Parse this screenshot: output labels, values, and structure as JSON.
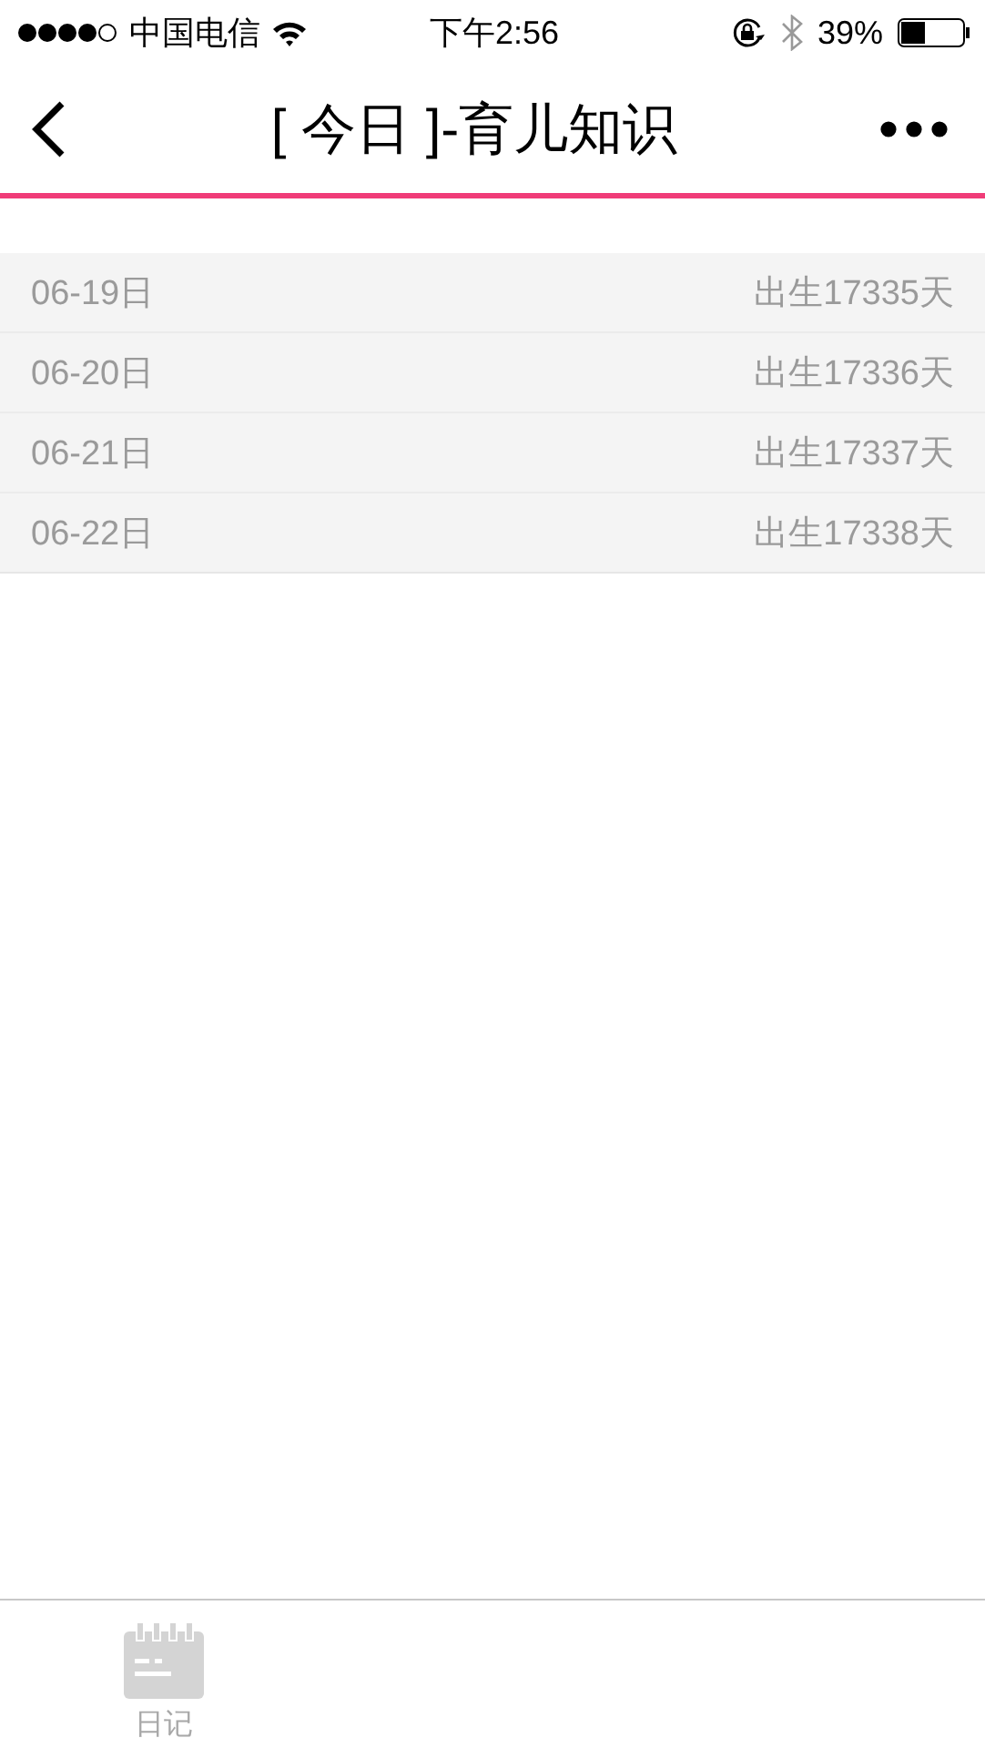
{
  "status_bar": {
    "carrier": "中国电信",
    "time": "下午2:56",
    "battery": "39%"
  },
  "nav": {
    "title": "[ 今日 ]-育儿知识"
  },
  "rows": [
    {
      "date": "06-19日",
      "days": "出生17335天"
    },
    {
      "date": "06-20日",
      "days": "出生17336天"
    },
    {
      "date": "06-21日",
      "days": "出生17337天"
    },
    {
      "date": "06-22日",
      "days": "出生17338天"
    }
  ],
  "tabs": [
    {
      "label": "日记",
      "selected": false
    }
  ]
}
